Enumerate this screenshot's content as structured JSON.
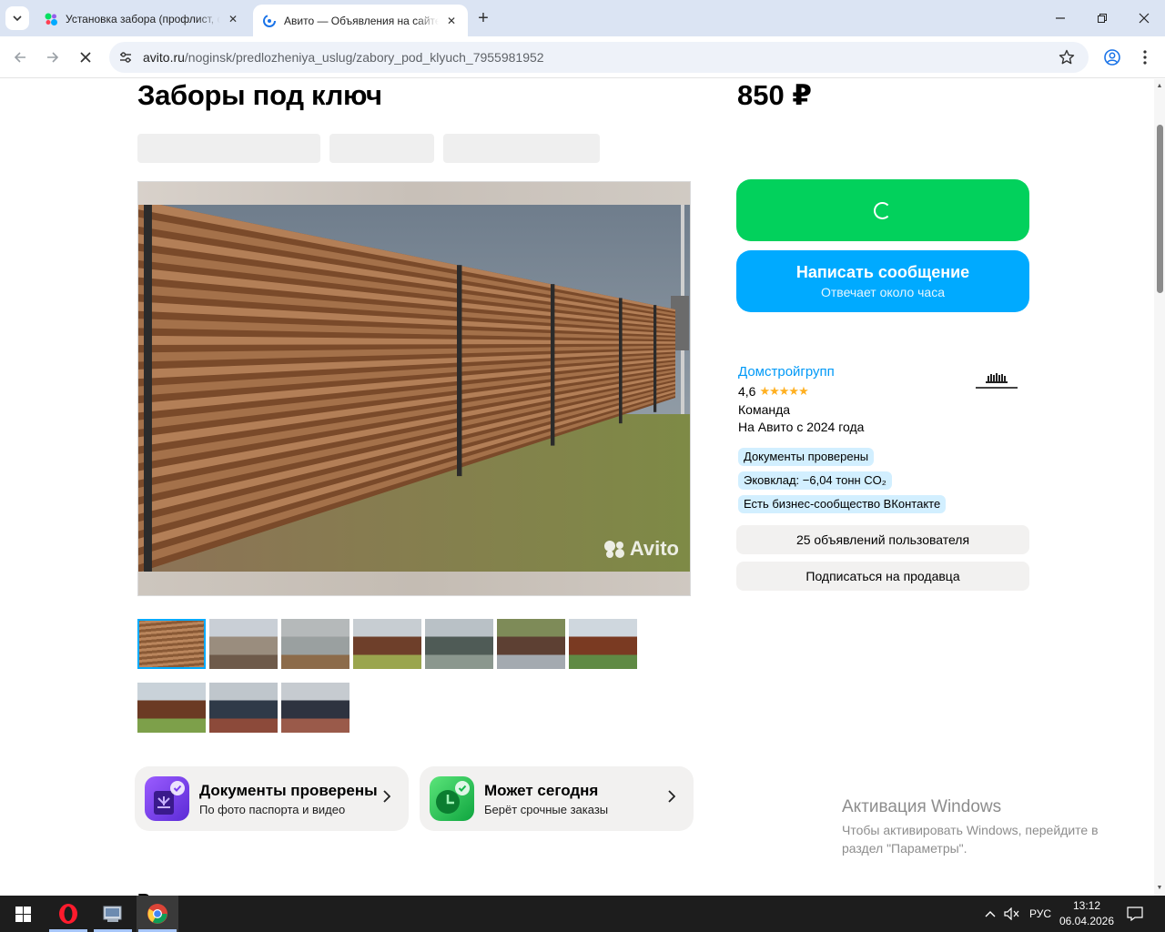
{
  "browser": {
    "tabs": [
      {
        "title": "Установка забора (профлист, с",
        "active": false
      },
      {
        "title": "Авито — Объявления на сайте",
        "active": true
      }
    ],
    "url_host": "avito.ru",
    "url_path": "/noginsk/predlozheniya_uslug/zabory_pod_klyuch_7955981952"
  },
  "listing": {
    "title": "Заборы под ключ",
    "price": "850 ₽",
    "watermark": "Avito",
    "thumbnail_count": 10,
    "selected_thumbnail": 0
  },
  "actions": {
    "message_label": "Написать сообщение",
    "message_sub": "Отвечает около часа"
  },
  "seller": {
    "name": "Домстройгрупп",
    "rating": "4,6",
    "type": "Команда",
    "since": "На Авито с 2024 года",
    "badges": [
      "Документы проверены",
      "Эковклад: −6,04 тонн CO₂",
      "Есть бизнес-сообщество ВКонтакте"
    ],
    "ads_button": "25 объявлений пользователя",
    "subscribe_button": "Подписаться на продавца"
  },
  "promos": [
    {
      "title": "Документы проверены",
      "subtitle": "По фото паспорта и видео",
      "color": "#7a3df0"
    },
    {
      "title": "Может сегодня",
      "subtitle": "Берёт срочные заказы",
      "color": "#14b84a"
    }
  ],
  "os": {
    "activation_title": "Активация Windows",
    "activation_text": "Чтобы активировать Windows, перейдите в раздел \"Параметры\".",
    "lang": "РУС",
    "time": "13:12",
    "date": "06.04.2026"
  },
  "colors": {
    "accent_blue": "#00aaff",
    "accent_green": "#02d15c",
    "link": "#0099f7"
  }
}
